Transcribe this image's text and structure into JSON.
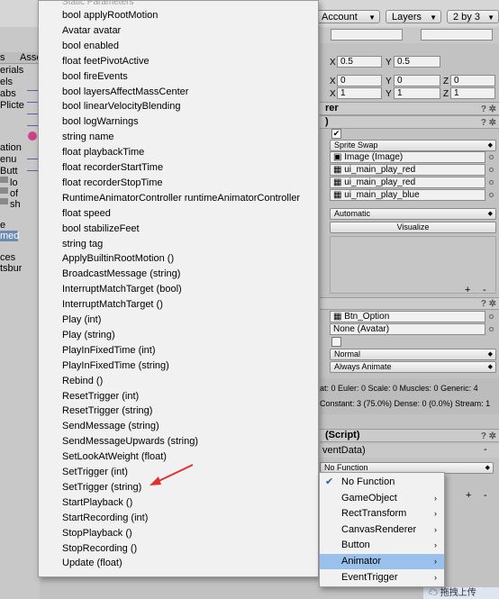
{
  "toolbar": {
    "account": "Account",
    "layers": "Layers",
    "layout": "2 by 3"
  },
  "left_panel": {
    "assets_tab": "Asse",
    "items": [
      "s",
      "erials",
      "els",
      "abs",
      "Plicte",
      "ation",
      "enu",
      "Butt",
      "lo",
      "of",
      "sh",
      "e",
      "med",
      "ces",
      "tsbur"
    ]
  },
  "inspector": {
    "pivot": {
      "x_label": "X",
      "x": "0.5",
      "y_label": "Y",
      "y": "0.5"
    },
    "rotation": {
      "x_label": "X",
      "x": "0",
      "y_label": "Y",
      "y": "0",
      "z_label": "Z",
      "z": "0"
    },
    "scale": {
      "x_label": "X",
      "x": "1",
      "y_label": "Y",
      "y": "1",
      "z_label": "Z",
      "z": "1"
    },
    "renderer_header": "rer",
    "button_header": ")",
    "transition": "Sprite Swap",
    "target_graphic": "Image (Image)",
    "sprite1": "ui_main_play_red",
    "sprite2": "ui_main_play_red",
    "sprite3": "ui_main_play_blue",
    "navigation": "Automatic",
    "visualize": "Visualize",
    "plus": "+",
    "minus": "-",
    "controller": "Btn_Option",
    "avatar": "None (Avatar)",
    "update_mode": "Normal",
    "culling_mode": "Always Animate",
    "stats1": "at: 0 Euler: 0 Scale: 0 Muscles: 0 Generic: 4",
    "stats2": "Constant: 3 (75.0%) Dense: 0 (0.0%) Stream: 1",
    "script_header": "(Script)",
    "event_data": "ventData)",
    "no_function": "No Function"
  },
  "method_list": {
    "header": "Static Parameters",
    "items": [
      "bool applyRootMotion",
      "Avatar avatar",
      "bool enabled",
      "float feetPivotActive",
      "bool fireEvents",
      "bool layersAffectMassCenter",
      "bool linearVelocityBlending",
      "bool logWarnings",
      "string name",
      "float playbackTime",
      "float recorderStartTime",
      "float recorderStopTime",
      "RuntimeAnimatorController runtimeAnimatorController",
      "float speed",
      "bool stabilizeFeet",
      "string tag",
      "ApplyBuiltinRootMotion ()",
      "BroadcastMessage (string)",
      "InterruptMatchTarget (bool)",
      "InterruptMatchTarget ()",
      "Play (int)",
      "Play (string)",
      "PlayInFixedTime (int)",
      "PlayInFixedTime (string)",
      "Rebind ()",
      "ResetTrigger (int)",
      "ResetTrigger (string)",
      "SendMessage (string)",
      "SendMessageUpwards (string)",
      "SetLookAtWeight (float)",
      "SetTrigger (int)",
      "SetTrigger (string)",
      "StartPlayback ()",
      "StartRecording (int)",
      "StopPlayback ()",
      "StopRecording ()",
      "Update (float)"
    ]
  },
  "context_menu": {
    "check": "✔",
    "items": [
      {
        "label": "No Function",
        "submenu": false,
        "checked": true
      },
      {
        "label": "GameObject",
        "submenu": true
      },
      {
        "label": "RectTransform",
        "submenu": true
      },
      {
        "label": "CanvasRenderer",
        "submenu": true
      },
      {
        "label": "Button",
        "submenu": true
      },
      {
        "label": "Animator",
        "submenu": true,
        "selected": true
      },
      {
        "label": "EventTrigger",
        "submenu": true
      }
    ],
    "submenu_arrow": "›"
  },
  "watermark": "拖拽上传",
  "colors": {
    "selection": "#99c1ec",
    "arrow": "#e03030"
  }
}
